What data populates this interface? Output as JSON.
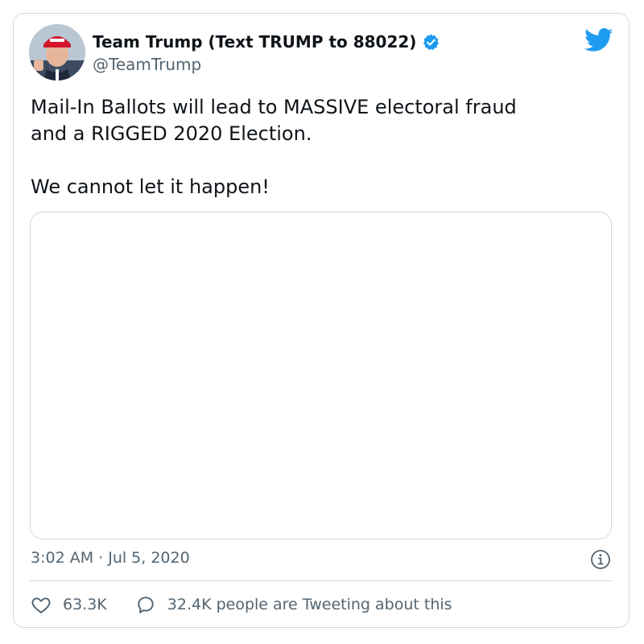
{
  "tweet": {
    "display_name": "Team Trump (Text TRUMP to 88022)",
    "handle": "@TeamTrump",
    "text": "Mail-In Ballots will lead to MASSIVE electoral fraud\nand a RIGGED 2020 Election.\n\nWe cannot let it happen!",
    "timestamp": "3:02 AM · Jul 5, 2020"
  },
  "actions": {
    "likes": "63.3K",
    "replies_label": "32.4K people are Tweeting about this"
  },
  "icons": {
    "brand": "twitter-bird-icon",
    "verified": "verified-badge-icon",
    "info": "info-icon",
    "like": "heart-icon",
    "reply": "speech-bubble-icon"
  },
  "colors": {
    "twitter_blue": "#1d9bf0",
    "text": "#0f1419",
    "secondary": "#536471",
    "border": "#cfd9de"
  }
}
